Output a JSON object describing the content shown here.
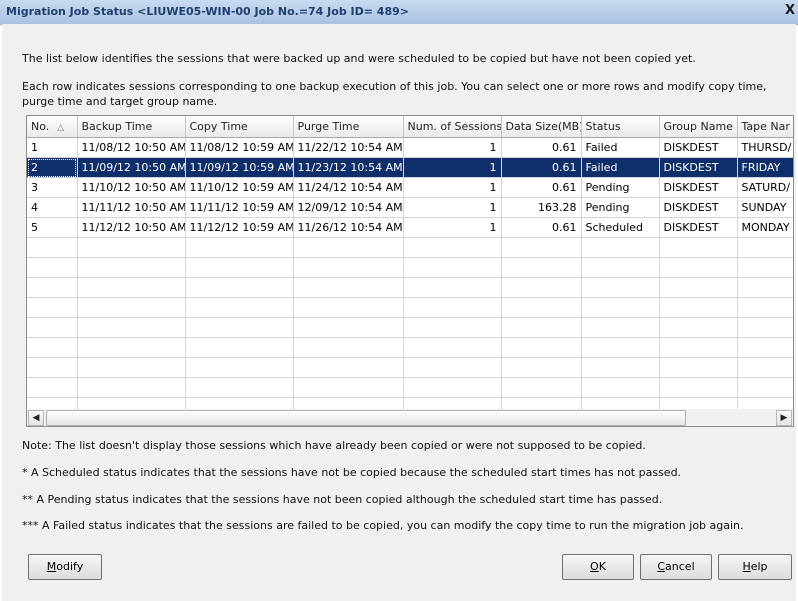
{
  "window": {
    "title": "Migration Job Status <LIUWE05-WIN-00 Job No.=74 Job ID= 489>",
    "close_glyph": "X"
  },
  "description": {
    "line1": "The list below identifies the sessions that were backed up and were scheduled to be copied but have not been copied yet.",
    "line2": "Each row indicates sessions corresponding to one backup execution of this job. You can select one or more rows and modify copy time, purge time and target group name."
  },
  "table": {
    "columns": [
      "No.",
      "Backup Time",
      "Copy Time",
      "Purge Time",
      "Num. of Sessions",
      "Data Size(MB)",
      "Status",
      "Group Name",
      "Tape Nar"
    ],
    "sort_indicator": "△",
    "rows": [
      [
        "1",
        "11/08/12  10:50 AM",
        "11/08/12  10:59 AM",
        "11/22/12  10:54 AM",
        "1",
        "0.61",
        "Failed",
        "DISKDEST",
        "THURSD/"
      ],
      [
        "2",
        "11/09/12  10:50 AM",
        "11/09/12  10:59 AM",
        "11/23/12  10:54 AM",
        "1",
        "0.61",
        "Failed",
        "DISKDEST",
        "FRIDAY"
      ],
      [
        "3",
        "11/10/12  10:50 AM",
        "11/10/12  10:59 AM",
        "11/24/12  10:54 AM",
        "1",
        "0.61",
        "Pending",
        "DISKDEST",
        "SATURD/"
      ],
      [
        "4",
        "11/11/12  10:50 AM",
        "11/11/12  10:59 AM",
        "12/09/12  10:54 AM",
        "1",
        "163.28",
        "Pending",
        "DISKDEST",
        "SUNDAY"
      ],
      [
        "5",
        "11/12/12  10:50 AM",
        "11/12/12  10:59 AM",
        "11/26/12  10:54 AM",
        "1",
        "0.61",
        "Scheduled",
        "DISKDEST",
        "MONDAY"
      ]
    ],
    "selected_row": 1
  },
  "scrollbar": {
    "left_arrow": "◀",
    "right_arrow": "▶"
  },
  "notes": [
    "Note: The list doesn't display those sessions which have already been copied or were not supposed to be copied.",
    "* A Scheduled status indicates that the sessions have not be copied because the scheduled start times has not passed.",
    "** A Pending status indicates that the sessions have not been copied although the scheduled start time has passed.",
    "*** A Failed status indicates that the sessions are failed to be copied, you can modify the copy time to run the migration job again."
  ],
  "buttons": {
    "modify": {
      "mnemonic": "M",
      "rest": "odify"
    },
    "ok": {
      "mnemonic": "O",
      "rest": "K"
    },
    "cancel": {
      "mnemonic": "C",
      "rest": "ancel"
    },
    "help": {
      "mnemonic": "H",
      "rest": "elp"
    }
  },
  "colors": {
    "selection": "#0f2f6b",
    "titlebar": "#a9c2e3",
    "title_text": "#1f3f6f"
  }
}
